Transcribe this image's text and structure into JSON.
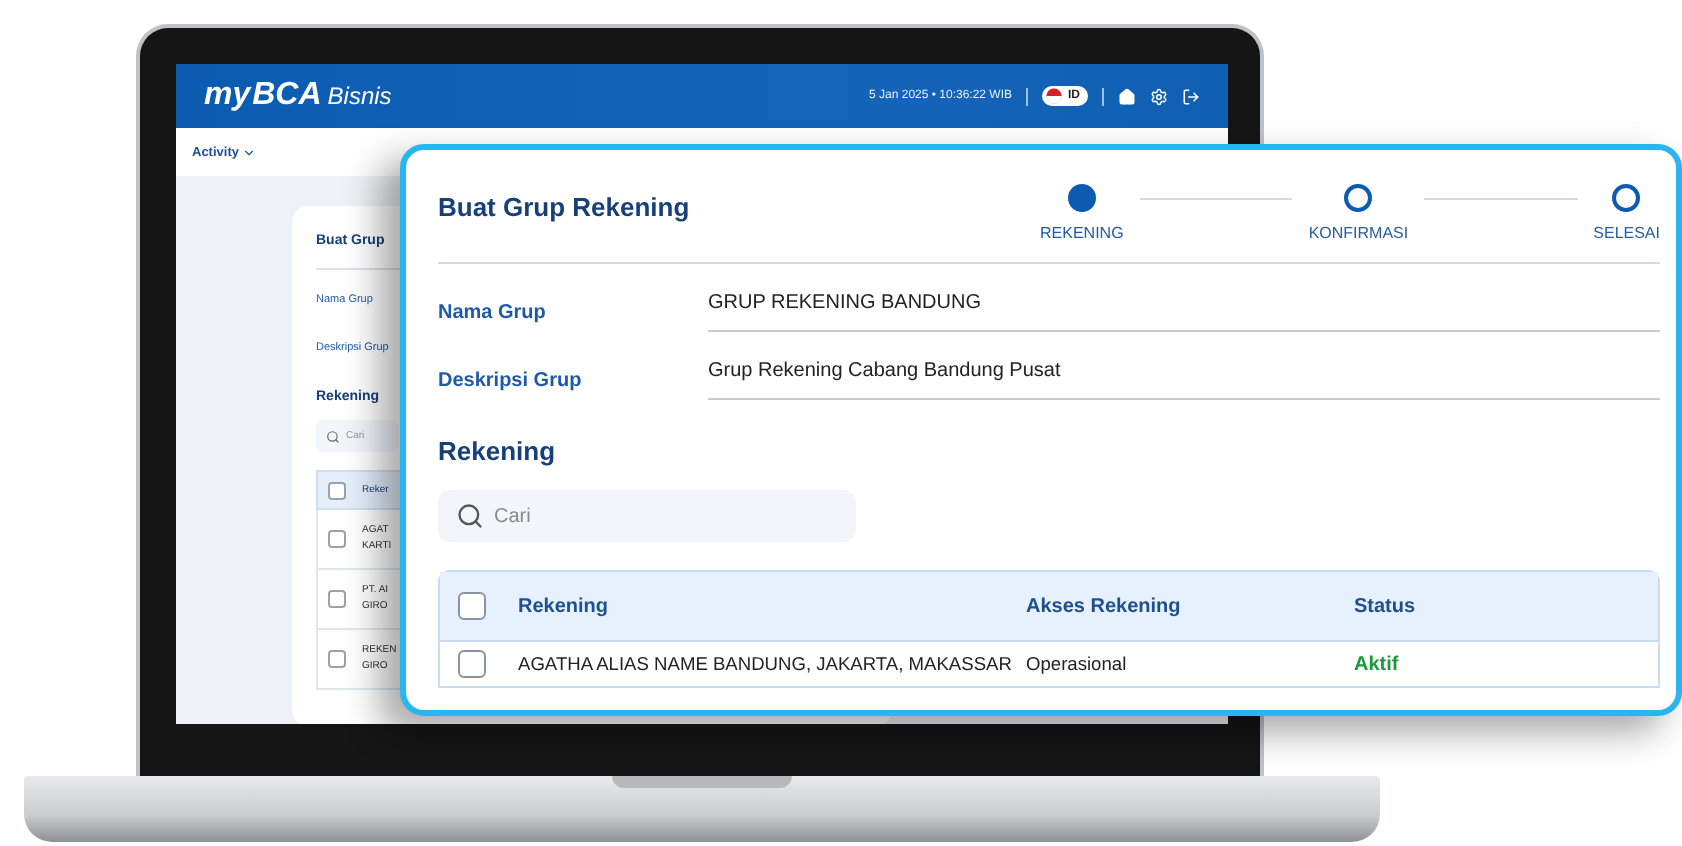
{
  "app": {
    "logo": {
      "prefix": "my",
      "brand": "BCA",
      "product": "Bisnis"
    },
    "datetime": "5 Jan 2025 • 10:36:22 WIB",
    "language": "ID"
  },
  "menu": {
    "label": "Activity"
  },
  "background_form": {
    "title": "Buat Grup",
    "fields": [
      "Nama Grup",
      "Deskripsi Grup"
    ],
    "section": "Rekening",
    "search_placeholder": "Cari",
    "select_all": {
      "checked": false
    },
    "column": "Reker",
    "rows": [
      {
        "checked": false,
        "lines": [
          "AGAT",
          "KARTI"
        ]
      },
      {
        "checked": false,
        "lines": [
          "PT. AI",
          "GIRO"
        ]
      },
      {
        "checked": false,
        "lines": [
          "REKEN",
          "GIRO"
        ]
      }
    ]
  },
  "dialog": {
    "title": "Buat Grup Rekening",
    "steps": [
      {
        "label": "REKENING",
        "active": true
      },
      {
        "label": "KONFIRMASI",
        "active": false
      },
      {
        "label": "SELESAI",
        "active": false
      }
    ],
    "fields": [
      {
        "label": "Nama Grup",
        "value": "GRUP REKENING BANDUNG"
      },
      {
        "label": "Deskripsi Grup",
        "value": "Grup Rekening Cabang Bandung Pusat"
      }
    ],
    "section": "Rekening",
    "search": {
      "placeholder": "Cari"
    },
    "table": {
      "select_all": {
        "checked": false
      },
      "columns": [
        "Rekening",
        "Akses Rekening",
        "Status"
      ],
      "rows": [
        {
          "checked": false,
          "cells": [
            "AGATHA ALIAS NAME BANDUNG, JAKARTA, MAKASSAR",
            "Operasional",
            "Aktif"
          ]
        }
      ]
    }
  }
}
